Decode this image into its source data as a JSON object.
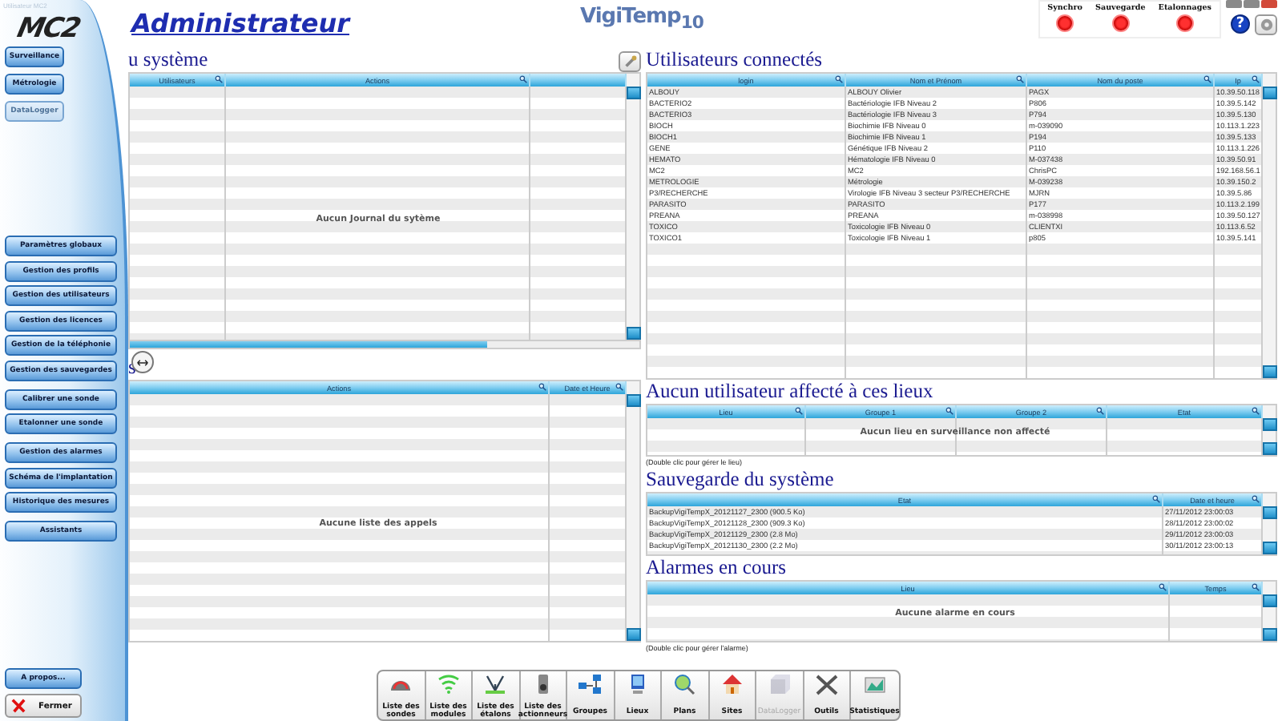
{
  "window": {
    "user_label": "Utilisateur MC2"
  },
  "logo": "MC2",
  "title": "Administrateur",
  "product": "VigiTemp$_{10}$",
  "indicators": [
    {
      "label": "Synchro",
      "on": true
    },
    {
      "label": "Sauvegarde",
      "on": true
    },
    {
      "label": "Etalonnages",
      "on": true
    }
  ],
  "help": "?",
  "sidebar": {
    "nav": [
      {
        "label": "Surveillance",
        "disabled": false
      },
      {
        "label": "Métrologie",
        "disabled": false
      },
      {
        "label": "DataLogger",
        "disabled": true
      }
    ],
    "groups": [
      [
        "Paramètres globaux",
        "Gestion des profils",
        "Gestion des utilisateurs",
        "Gestion des licences",
        "Gestion de la téléphonie",
        "Gestion des sauvegardes"
      ],
      [
        "Calibrer une sonde",
        "Etalonner une sonde"
      ],
      [
        "Gestion des alarmes",
        "Schéma de l'implantation",
        "Historique des mesures"
      ],
      [
        "Assistants"
      ]
    ],
    "about": "A propos...",
    "close": "Fermer"
  },
  "journal": {
    "title": "u système",
    "columns": [
      "Utilisateurs",
      "Actions"
    ],
    "empty_message": "Aucun Journal du sytème"
  },
  "calls": {
    "title": "s",
    "columns": [
      "Actions",
      "Date et Heure"
    ],
    "empty_message": "Aucune liste des appels"
  },
  "connected_users": {
    "title": "Utilisateurs connectés",
    "columns": [
      "login",
      "Nom et Prénom",
      "Nom du poste",
      "Ip"
    ],
    "rows": [
      [
        "ALBOUY",
        "ALBOUY  Olivier",
        "PAGX",
        "10.39.50.118"
      ],
      [
        "BACTERIO2",
        "Bactériologie IFB Niveau 2",
        "P806",
        "10.39.5.142"
      ],
      [
        "BACTERIO3",
        "Bactériologie IFB Niveau 3",
        "P794",
        "10.39.5.130"
      ],
      [
        "BIOCH",
        "Biochimie IFB Niveau 0",
        "m-039090",
        "10.113.1.223"
      ],
      [
        "BIOCH1",
        "Biochimie IFB Niveau 1",
        "P194",
        "10.39.5.133"
      ],
      [
        "GENE",
        "Génétique IFB Niveau 2",
        "P110",
        "10.113.1.226"
      ],
      [
        "HEMATO",
        "Hématologie IFB Niveau 0",
        "M-037438",
        "10.39.50.91"
      ],
      [
        "MC2",
        "MC2",
        "ChrisPC",
        "192.168.56.1"
      ],
      [
        "METROLOGIE",
        "Métrologie",
        "M-039238",
        "10.39.150.2"
      ],
      [
        "P3/RECHERCHE",
        "Virologie IFB Niveau 3 secteur P3/RECHERCHE",
        "MJRN",
        "10.39.5.86"
      ],
      [
        "PARASITO",
        "PARASITO",
        "P177",
        "10.113.2.199"
      ],
      [
        "PREANA",
        "PREANA",
        "m-038998",
        "10.39.50.127"
      ],
      [
        "TOXICO",
        "Toxicologie IFB Niveau 0",
        "CLIENTXI",
        "10.113.6.52"
      ],
      [
        "TOXICO1",
        "Toxicologie IFB Niveau 1",
        "p805",
        "10.39.5.141"
      ]
    ]
  },
  "unassigned": {
    "title": "Aucun utilisateur affecté à ces lieux",
    "columns": [
      "Lieu",
      "Groupe 1",
      "Groupe 2",
      "Etat"
    ],
    "empty_message": "Aucun lieu en surveillance non affecté",
    "hint": "(Double clic pour gérer le lieu)"
  },
  "backup": {
    "title": "Sauvegarde du système",
    "columns": [
      "Etat",
      "Date et heure"
    ],
    "rows": [
      [
        "BackupVigiTempX_20121127_2300 (900.5 Ko)",
        "27/11/2012 23:00:03"
      ],
      [
        "BackupVigiTempX_20121128_2300 (909.3 Ko)",
        "28/11/2012 23:00:02"
      ],
      [
        "BackupVigiTempX_20121129_2300 (2.8 Mo)",
        "29/11/2012 23:00:03"
      ],
      [
        "BackupVigiTempX_20121130_2300 (2.2 Mo)",
        "30/11/2012 23:00:13"
      ]
    ]
  },
  "alarms": {
    "title": "Alarmes en cours",
    "columns": [
      "Lieu",
      "Temps"
    ],
    "empty_message": "Aucune alarme en cours",
    "hint": "(Double clic pour gérer l'alarme)"
  },
  "toolbar": [
    {
      "label": "Liste des sondes",
      "disabled": false
    },
    {
      "label": "Liste des modules",
      "disabled": false
    },
    {
      "label": "Liste des étalons",
      "disabled": false
    },
    {
      "label": "Liste des actionneurs",
      "disabled": false
    },
    {
      "label": "Groupes",
      "disabled": false
    },
    {
      "label": "Lieux",
      "disabled": false
    },
    {
      "label": "Plans",
      "disabled": false
    },
    {
      "label": "Sites",
      "disabled": false
    },
    {
      "label": "DataLogger",
      "disabled": true
    },
    {
      "label": "Outils",
      "disabled": false
    },
    {
      "label": "Statistiques",
      "disabled": false
    }
  ]
}
